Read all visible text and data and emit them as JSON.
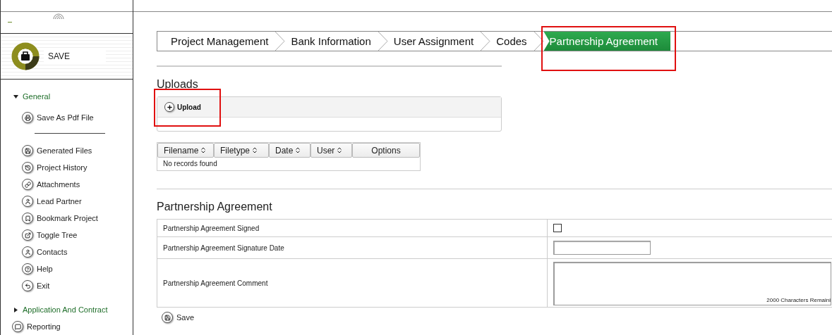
{
  "sidebar": {
    "save_label": "SAVE",
    "items": [
      {
        "kind": "group",
        "label": "General",
        "expanded": true,
        "children": [
          {
            "kind": "item",
            "label": "Save As Pdf File"
          },
          {
            "kind": "separator"
          },
          {
            "kind": "item",
            "label": "Generated Files"
          },
          {
            "kind": "item",
            "label": "Project History"
          },
          {
            "kind": "item",
            "label": "Attachments"
          },
          {
            "kind": "item",
            "label": "Lead Partner"
          },
          {
            "kind": "item",
            "label": "Bookmark Project"
          },
          {
            "kind": "item",
            "label": "Toggle Tree"
          },
          {
            "kind": "item",
            "label": "Contacts"
          },
          {
            "kind": "item",
            "label": "Help"
          },
          {
            "kind": "item",
            "label": "Exit"
          }
        ]
      },
      {
        "kind": "group",
        "label": "Application And Contract",
        "expanded": false
      },
      {
        "kind": "item",
        "label": "Reporting"
      }
    ]
  },
  "tabs": [
    {
      "label": "Project Management",
      "selected": false,
      "highlighted": false
    },
    {
      "label": "Bank Information",
      "selected": false,
      "highlighted": false
    },
    {
      "label": "User Assignment",
      "selected": false,
      "highlighted": false
    },
    {
      "label": "Codes",
      "selected": false,
      "highlighted": false
    },
    {
      "label": "Partnership Agreement",
      "selected": true,
      "highlighted": true
    }
  ],
  "uploads": {
    "title": "Uploads",
    "upload_button": {
      "label": "Upload",
      "highlighted": true
    },
    "table": {
      "columns": [
        {
          "label": "Filename",
          "sortable": true
        },
        {
          "label": "Filetype",
          "sortable": true
        },
        {
          "label": "Date",
          "sortable": true
        },
        {
          "label": "User",
          "sortable": true
        },
        {
          "label": "Options",
          "sortable": false
        }
      ],
      "empty_text": "No records found"
    }
  },
  "agreement": {
    "title": "Partnership Agreement",
    "fields": [
      {
        "kind": "checkbox",
        "label": "Partnership Agreement Signed",
        "checked": false
      },
      {
        "kind": "date",
        "label": "Partnership Agreement Signature Date"
      },
      {
        "kind": "textarea",
        "label": "Partnership Agreement Comment",
        "counter": "2000 Characters Remaini"
      }
    ],
    "save_label": "Save"
  }
}
